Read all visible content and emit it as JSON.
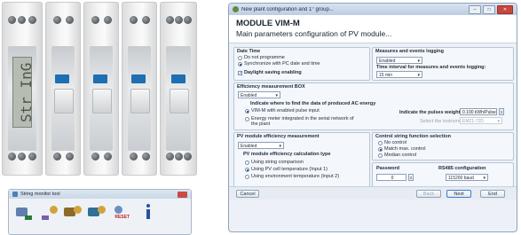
{
  "hardware": {
    "module1_display": "Str InG",
    "module_count": 5
  },
  "tool_window": {
    "title": "String monitor tool",
    "reset_label": "RESET",
    "icons": [
      "setup-icon",
      "graph-icon",
      "tools-icon",
      "tools-icon",
      "reset-icon",
      "info-icon"
    ]
  },
  "dialog": {
    "title": "New plant configuration and 1° group...",
    "window_buttons": {
      "minimize": "–",
      "maximize": "□",
      "close": "✕"
    },
    "header_title": "MODULE VIM-M",
    "header_subtitle": "Main parameters configuration of PV module...",
    "date_time": {
      "legend": "Date Time",
      "opt1": "Do not programme",
      "opt2": "Synchronize with PC date and time",
      "daylight": "Daylight saving enabling"
    },
    "measures": {
      "legend": "Measures and events logging",
      "status": "Enabled",
      "interval_label": "Time interval for measures and events logging:",
      "interval_value": "15 min"
    },
    "efficiency": {
      "legend": "Efficiency measurement BOX",
      "status": "Enabled",
      "where_label": "Indicate where to find the data of produced AC energy",
      "opt1": "VIM-M with enabled pulse input",
      "opt2": "Energy meter integrated in the serial network of",
      "opt2b": "the plant",
      "pulse_label": "Indicate the pulses weight:",
      "pulse_value": "0.100 kWh/Pulse",
      "instrument_label": "Select the instrument:",
      "instrument_value": "EM21-72D"
    },
    "pv": {
      "legend": "PV module efficiency measurement",
      "status": "Enabled",
      "calc_label": "PV module efficiency calculation type",
      "opt1": "Using string comparison",
      "opt2": "Using PV cell temperature (Input 1)",
      "opt3": "Using environment temperature (Input 2)"
    },
    "control": {
      "legend": "Control string function selection",
      "opt1": "No control",
      "opt2": "Match max. control",
      "opt3": "Median control"
    },
    "password": {
      "label": "Password",
      "value": "0"
    },
    "rs485": {
      "label": "RS485 configuration",
      "value": "115200 baud"
    },
    "buttons": {
      "cancel": "Cancel",
      "back": "Back",
      "next": "Next",
      "end": "End"
    }
  }
}
